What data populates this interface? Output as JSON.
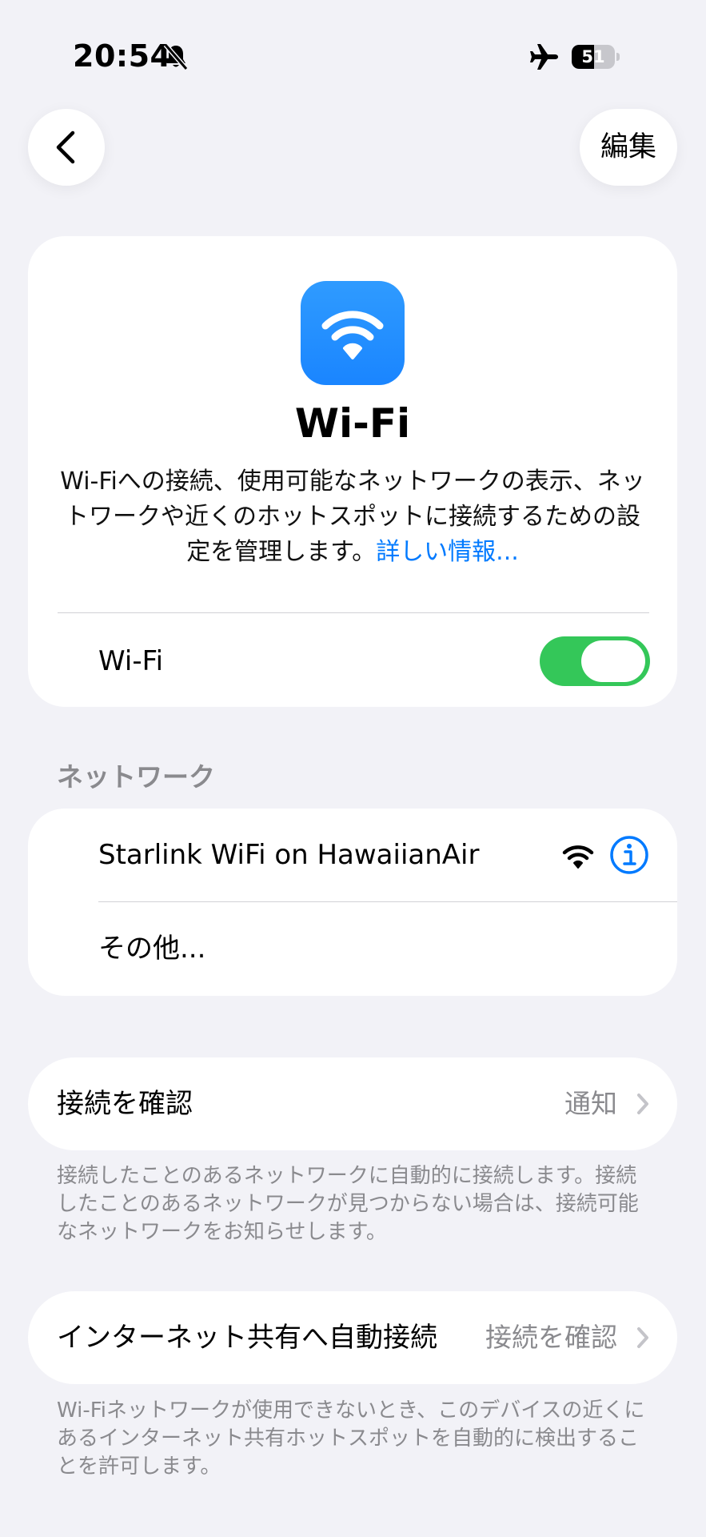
{
  "status_bar": {
    "time": "20:54",
    "battery_level": "51",
    "battery_fraction": 0.51,
    "icons": [
      "bell-slash-icon",
      "airplane-icon",
      "battery-icon"
    ]
  },
  "nav": {
    "back_icon": "chevron-left-icon",
    "edit_label": "編集"
  },
  "hero": {
    "icon": "wifi-icon",
    "title": "Wi-Fi",
    "description": "Wi-Fiへの接続、使用可能なネットワークの表示、ネットワークや近くのホットスポットに接続するための設定を管理します。",
    "link": "詳しい情報...",
    "toggle_label": "Wi-Fi",
    "toggle_on": true
  },
  "networks": {
    "header": "ネットワーク",
    "items": [
      {
        "name": "Starlink WiFi on HawaiianAir",
        "signal_icon": "wifi-signal-icon",
        "info_icon": "info-icon"
      },
      {
        "name": "その他..."
      }
    ]
  },
  "ask_to_join": {
    "title": "接続を確認",
    "value": "通知",
    "footnote": "接続したことのあるネットワークに自動的に接続します。接続したことのあるネットワークが見つからない場合は、接続可能なネットワークをお知らせします。"
  },
  "auto_hotspot": {
    "title": "インターネット共有へ自動接続",
    "value": "接続を確認",
    "footnote": "Wi-Fiネットワークが使用できないとき、このデバイスの近くにあるインターネット共有ホットスポットを自動的に検出することを許可します。"
  },
  "colors": {
    "background": "#f2f2f7",
    "accent": "#007aff",
    "toggle_on": "#34c759",
    "secondary_text": "#8a8a8e"
  }
}
